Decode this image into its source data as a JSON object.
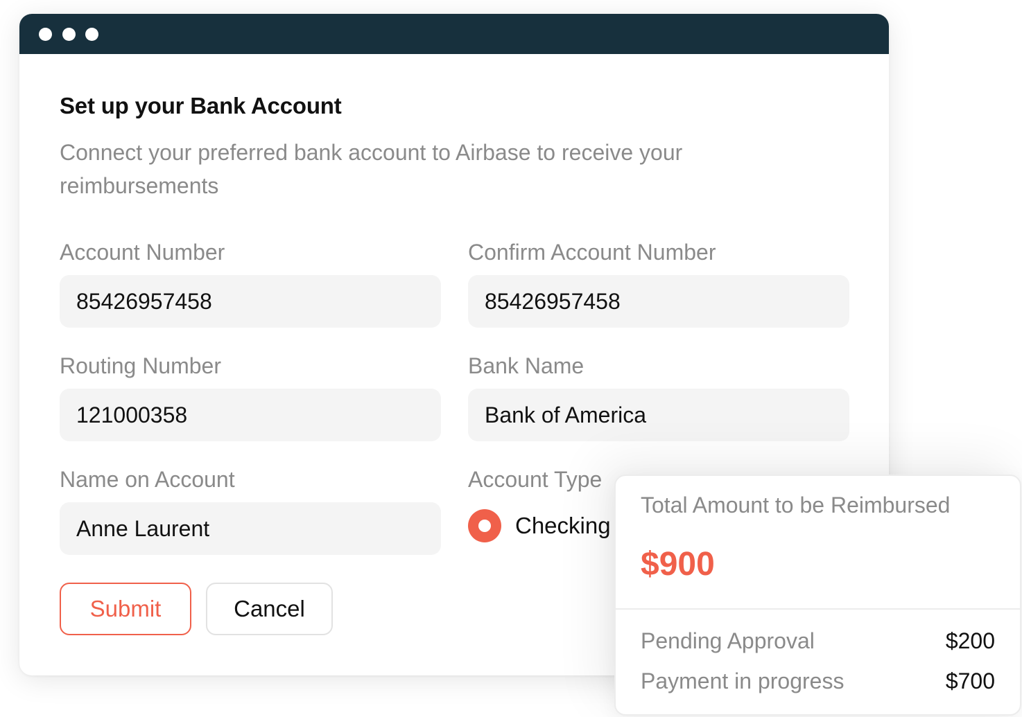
{
  "form": {
    "title": "Set up your Bank Account",
    "description": "Connect your preferred bank account to Airbase to receive your reimbursements",
    "fields": {
      "account_number": {
        "label": "Account Number",
        "value": "85426957458"
      },
      "confirm_account_number": {
        "label": "Confirm Account Number",
        "value": "85426957458"
      },
      "routing_number": {
        "label": "Routing Number",
        "value": "121000358"
      },
      "bank_name": {
        "label": "Bank Name",
        "value": "Bank of America"
      },
      "name_on_account": {
        "label": "Name on Account",
        "value": "Anne Laurent"
      }
    },
    "account_type": {
      "label": "Account Type",
      "selected_option": "Checking"
    },
    "buttons": {
      "submit": "Submit",
      "cancel": "Cancel"
    }
  },
  "summary": {
    "title": "Total Amount to be Reimbursed",
    "total": "$900",
    "rows": [
      {
        "label": "Pending Approval",
        "value": "$200"
      },
      {
        "label": "Payment in progress",
        "value": "$700"
      }
    ]
  },
  "colors": {
    "titlebar": "#17303d",
    "accent": "#f0604a",
    "muted_text": "#8a8a8a",
    "input_background": "#f4f4f4"
  }
}
